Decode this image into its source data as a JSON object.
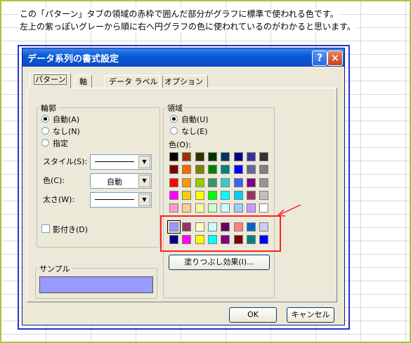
{
  "notes": {
    "line1": "この「パターン」タブの領域の赤枠で囲んだ部分がグラフに標準で使われる色です。",
    "line2": "左上の紫っぽいグレーから順に右へ円グラフの色に使われているのがわかると思います。"
  },
  "dialog": {
    "title": "データ系列の書式設定",
    "help": "?",
    "close": "×",
    "tabs": [
      "パターン",
      "軸",
      "データ ラベル",
      "オプション"
    ],
    "border": {
      "legend": "輪郭",
      "radio_auto": "自動(A)",
      "radio_none": "なし(N)",
      "radio_custom": "指定",
      "style_label": "スタイル(S):",
      "color_label": "色(C):",
      "color_value": "自動",
      "weight_label": "太さ(W):",
      "shadow_label": "影付き(D)",
      "sample_legend": "サンプル"
    },
    "area": {
      "legend": "領域",
      "radio_auto": "自動(U)",
      "radio_none": "なし(E)",
      "color_label": "色(O):",
      "fill_button": "塗りつぶし効果(I)..."
    },
    "ok": "OK",
    "cancel": "キャンセル"
  },
  "colors": {
    "sample_fill": "#9999ff",
    "palette_main": [
      [
        "#000000",
        "#993300",
        "#333300",
        "#003300",
        "#003366",
        "#000080",
        "#333399",
        "#333333"
      ],
      [
        "#800000",
        "#ff6600",
        "#808000",
        "#008000",
        "#008080",
        "#0000ff",
        "#666699",
        "#808080"
      ],
      [
        "#ff0000",
        "#ff9900",
        "#99cc00",
        "#339966",
        "#33cccc",
        "#3366ff",
        "#800080",
        "#969696"
      ],
      [
        "#ff00ff",
        "#ffcc00",
        "#ffff00",
        "#00ff00",
        "#00ffff",
        "#00ccff",
        "#993366",
        "#c0c0c0"
      ],
      [
        "#ff99cc",
        "#ffcc99",
        "#ffff99",
        "#ccffcc",
        "#ccffff",
        "#99ccff",
        "#cc99ff",
        "#ffffff"
      ]
    ],
    "palette_chart": [
      [
        "#9999ff",
        "#993366",
        "#ffffcc",
        "#ccffff",
        "#660066",
        "#ff8080",
        "#0066cc",
        "#ccccff"
      ],
      [
        "#000080",
        "#ff00ff",
        "#ffff00",
        "#00ffff",
        "#800080",
        "#800000",
        "#008080",
        "#0000ff"
      ]
    ]
  }
}
